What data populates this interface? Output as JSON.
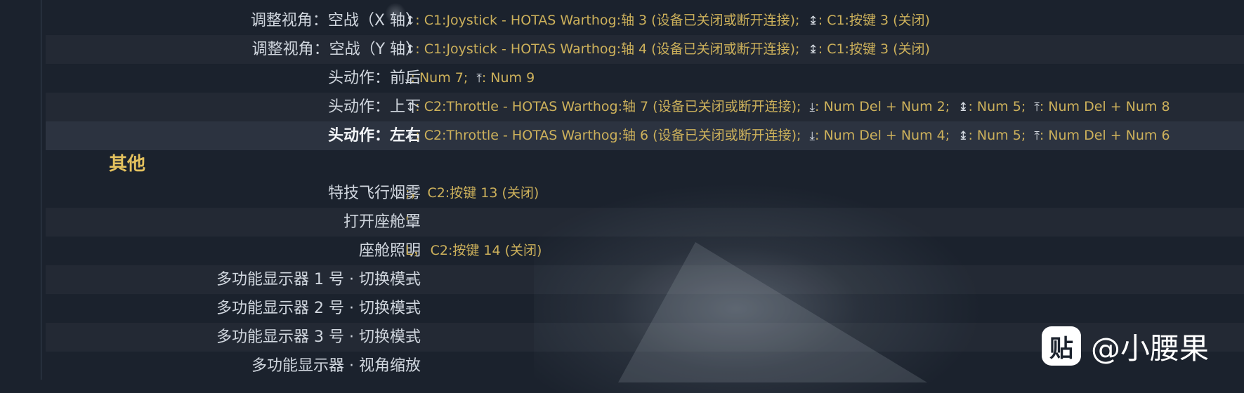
{
  "rows": [
    {
      "label": "调整视角：空战（X 轴）",
      "v1_sym": "↕",
      "v1": ": C1:Joystick - HOTAS Warthog:轴 3 (设备已关闭或断开连接);",
      "v2_sym": "↨",
      "v2": ": C1:按键 3 (关闭)"
    },
    {
      "label": "调整视角：空战（Y 轴）",
      "v1_sym": "↕",
      "v1": ": C1:Joystick - HOTAS Warthog:轴 4 (设备已关闭或断开连接);",
      "v2_sym": "↨",
      "v2": ": C1:按键 3 (关闭)"
    },
    {
      "label": "头动作：前后",
      "v1_sym": "⤓",
      "v1": ": Num 7;",
      "v2_sym": "⤒",
      "v2": ": Num 9"
    },
    {
      "label": "头动作：上下",
      "v1_sym": "↕",
      "v1": ": C2:Throttle - HOTAS Warthog:轴 7 (设备已关闭或断开连接);",
      "v2_sym": "⤓",
      "v2": ": Num Del + Num 2;",
      "v3_sym": "↨",
      "v3": ": Num 5;",
      "v4_sym": "⤒",
      "v4": ": Num Del + Num 8"
    },
    {
      "label": "头动作：左右",
      "v1_sym": "↕",
      "v1": ": C2:Throttle - HOTAS Warthog:轴 6 (设备已关闭或断开连接);",
      "v2_sym": "⤓",
      "v2": ": Num Del + Num 4;",
      "v3_sym": "↨",
      "v3": ": Num 5;",
      "v4_sym": "⤒",
      "v4": ": Num Del + Num 6"
    }
  ],
  "section_title": "其他",
  "rows2": [
    {
      "label": "特技飞行烟雾",
      "value": ";，  C2:按键 13 (关闭)"
    },
    {
      "label": "打开座舱罩",
      "value": "'"
    },
    {
      "label": "座舱照明",
      "value": "L，  C2:按键 14 (关闭)"
    },
    {
      "label": "多功能显示器 1 号 · 切换模式",
      "value": "---"
    },
    {
      "label": "多功能显示器 2 号 · 切换模式",
      "value": "---"
    },
    {
      "label": "多功能显示器 3 号 · 切换模式",
      "value": "---"
    },
    {
      "label": "多功能显示器 · 视角缩放",
      "value": "---"
    }
  ],
  "watermark": {
    "logo": "贴",
    "text": "@小腰果"
  },
  "colors": {
    "accent": "#cdb15b",
    "section": "#e3c15e",
    "background": "#1b222d"
  }
}
